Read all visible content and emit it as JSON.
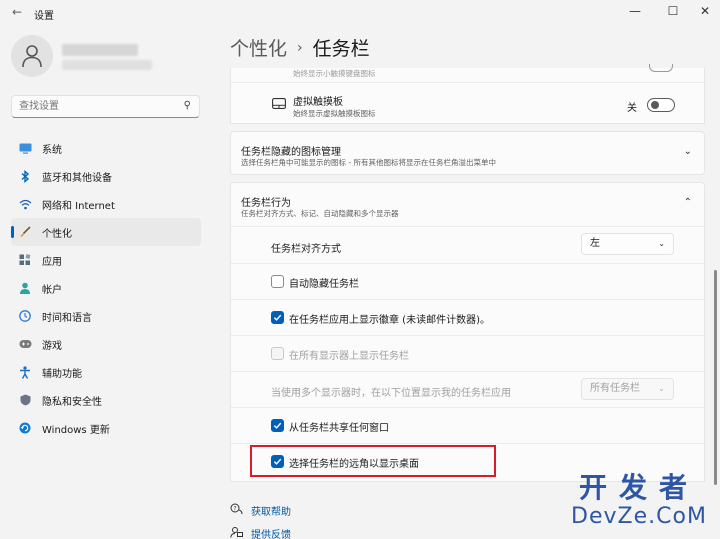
{
  "window": {
    "title": "设置",
    "back_icon": "back-arrow-icon",
    "minimize": "—",
    "maximize": "☐",
    "close": "✕"
  },
  "sidebar": {
    "search_placeholder": "查找设置",
    "items": [
      {
        "label": "系统",
        "icon": "monitor-icon",
        "color": "#0078d4"
      },
      {
        "label": "蓝牙和其他设备",
        "icon": "bluetooth-icon",
        "color": "#0067c0"
      },
      {
        "label": "网络和 Internet",
        "icon": "wifi-icon",
        "color": "#1c5fa8"
      },
      {
        "label": "个性化",
        "icon": "brush-icon",
        "color": "#e09a3c",
        "active": true
      },
      {
        "label": "应用",
        "icon": "apps-icon",
        "color": "#5a6b80"
      },
      {
        "label": "帐户",
        "icon": "person-icon",
        "color": "#2aa5a0"
      },
      {
        "label": "时间和语言",
        "icon": "globe-clock-icon",
        "color": "#2a7fd4"
      },
      {
        "label": "游戏",
        "icon": "gamepad-icon",
        "color": "#6b6b6b"
      },
      {
        "label": "辅助功能",
        "icon": "accessibility-icon",
        "color": "#1a6ec2"
      },
      {
        "label": "隐私和安全性",
        "icon": "shield-icon",
        "color": "#6b7585"
      },
      {
        "label": "Windows 更新",
        "icon": "update-icon",
        "color": "#0f7bd6"
      }
    ]
  },
  "breadcrumb": {
    "parent": "个性化",
    "separator": "›",
    "current": "任务栏"
  },
  "cards": {
    "touchpad": {
      "partial_sub": "始终显示小触摸键盘图标",
      "title": "虚拟触摸板",
      "sub": "始终显示虚拟触摸板图标",
      "toggle_label": "关",
      "toggle_on": false
    },
    "hidden_icons": {
      "title": "任务栏隐藏的图标管理",
      "sub": "选择任务栏角中可能显示的图标 - 所有其他图标将显示在任务栏角溢出菜单中"
    },
    "behaviors": {
      "title": "任务栏行为",
      "sub": "任务栏对齐方式、标记、自动隐藏和多个显示器",
      "alignment_label": "任务栏对齐方式",
      "alignment_value": "左",
      "auto_hide": {
        "label": "自动隐藏任务栏",
        "checked": false
      },
      "badges": {
        "label": "在任务栏应用上显示徽章 (未读邮件计数器)。",
        "checked": true
      },
      "all_displays": {
        "label": "在所有显示器上显示任务栏",
        "checked": false,
        "disabled": true
      },
      "multi_display_label": "当使用多个显示器时，在以下位置显示我的任务栏应用",
      "multi_display_value": "所有任务栏",
      "share_window": {
        "label": "从任务栏共享任何窗口",
        "checked": true
      },
      "far_corner": {
        "label": "选择任务栏的远角以显示桌面",
        "checked": true
      }
    }
  },
  "footer": {
    "help": "获取帮助",
    "feedback": "提供反馈"
  },
  "watermark": {
    "line1": "开发者",
    "line2": "DevZe.CoM"
  },
  "colors": {
    "accent": "#005fb8",
    "highlight_box": "#d41e2a",
    "link": "#0057a8"
  }
}
